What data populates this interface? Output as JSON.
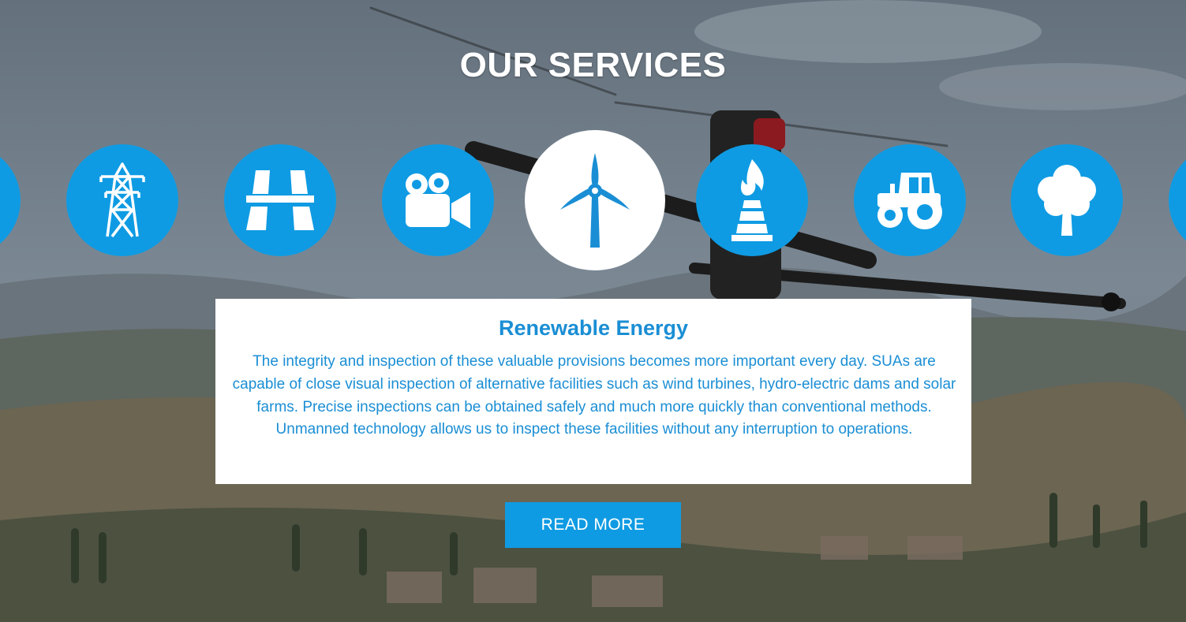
{
  "section": {
    "title": "OUR SERVICES"
  },
  "services": [
    {
      "icon": "partial-service-icon",
      "active": false
    },
    {
      "icon": "power-tower-icon",
      "active": false
    },
    {
      "icon": "road-highway-icon",
      "active": false
    },
    {
      "icon": "video-camera-icon",
      "active": false
    },
    {
      "icon": "wind-turbine-icon",
      "active": true
    },
    {
      "icon": "gas-flare-icon",
      "active": false
    },
    {
      "icon": "tractor-icon",
      "active": false
    },
    {
      "icon": "tree-icon",
      "active": false
    },
    {
      "icon": "partial-service-icon",
      "active": false
    }
  ],
  "detail": {
    "heading": "Renewable Energy",
    "body": "The integrity and inspection of these valuable provisions becomes more important every day. SUAs are capable of close visual inspection of alternative facilities such as wind turbines, hydro-electric dams and solar farms. Precise inspections can be obtained safely and much more quickly than conventional methods. Unmanned technology allows us to inspect these facilities without any interruption to operations."
  },
  "read_more": {
    "label": "READ MORE"
  },
  "colors": {
    "accent": "#0f9be3",
    "heading_text": "#1a8ed4"
  }
}
